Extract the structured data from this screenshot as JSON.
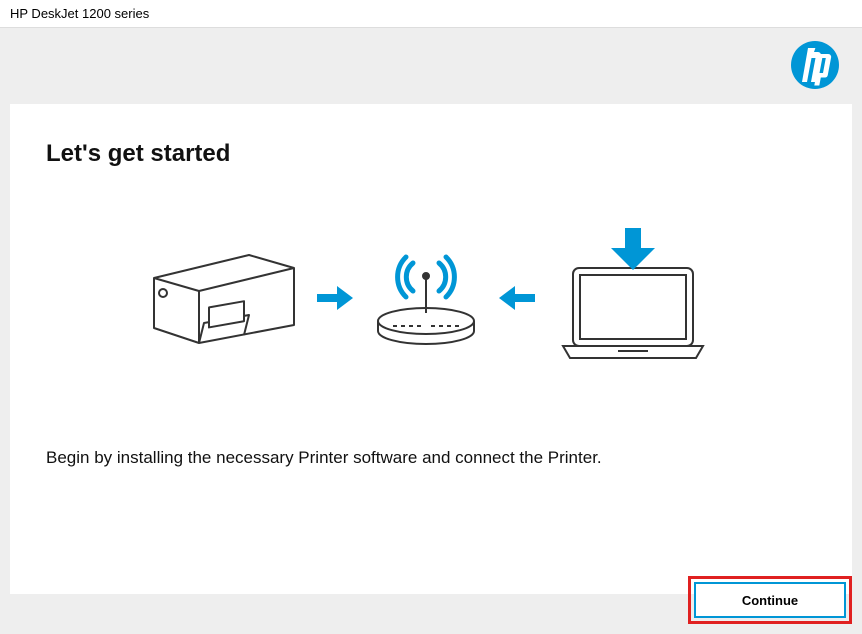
{
  "window": {
    "title": "HP DeskJet 1200 series"
  },
  "brand": {
    "name": "hp",
    "accent": "#0096d6"
  },
  "main": {
    "heading": "Let's get started",
    "description": "Begin by installing the necessary Printer software and connect the Printer."
  },
  "illustration": {
    "items": [
      "printer",
      "arrow-right",
      "wireless-router",
      "arrow-left",
      "laptop-download"
    ]
  },
  "action": {
    "continue_label": "Continue",
    "highlighted": true
  }
}
